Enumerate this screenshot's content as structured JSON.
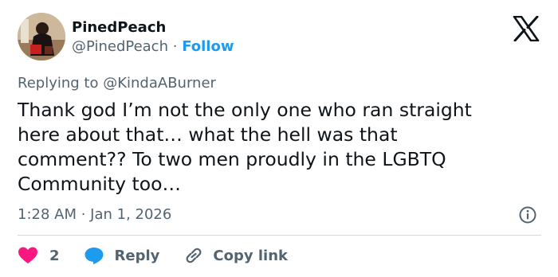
{
  "author": {
    "name": "PinedPeach",
    "handle": "@PinedPeach",
    "separator": "·",
    "follow_label": "Follow"
  },
  "reply_context": {
    "prefix": "Replying to",
    "mention": "@KindaABurner"
  },
  "body": {
    "lines": [
      "Thank god I’m not the only one who ran straight",
      "here about that… what the hell was that",
      "comment?? To two men proudly in the LGBTQ",
      "Community too…"
    ]
  },
  "meta": {
    "timestamp": "1:28 AM · Jan 1, 2026"
  },
  "actions": {
    "like_count": "2",
    "reply_label": "Reply",
    "copy_link_label": "Copy link"
  },
  "icons": {
    "platform": "x-logo-icon",
    "info": "info-icon",
    "like": "heart-icon",
    "reply": "speech-bubble-icon",
    "copy": "link-icon"
  },
  "colors": {
    "text": "#0f1419",
    "secondary": "#536471",
    "accent": "#1d9bf0",
    "like": "#f91880",
    "divider": "#cfd9de"
  }
}
